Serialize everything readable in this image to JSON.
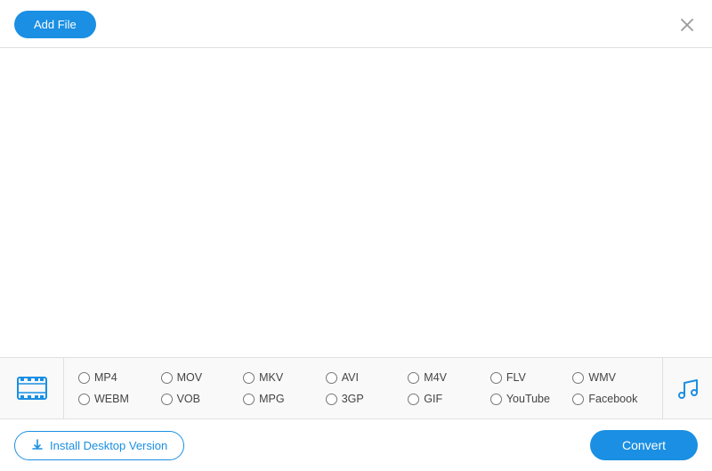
{
  "header": {
    "add_file_label": "Add File",
    "close_label": "✕"
  },
  "formats": {
    "video": [
      {
        "id": "mp4",
        "label": "MP4"
      },
      {
        "id": "mov",
        "label": "MOV"
      },
      {
        "id": "mkv",
        "label": "MKV"
      },
      {
        "id": "avi",
        "label": "AVI"
      },
      {
        "id": "m4v",
        "label": "M4V"
      },
      {
        "id": "flv",
        "label": "FLV"
      },
      {
        "id": "wmv",
        "label": "WMV"
      },
      {
        "id": "webm",
        "label": "WEBM"
      },
      {
        "id": "vob",
        "label": "VOB"
      },
      {
        "id": "mpg",
        "label": "MPG"
      },
      {
        "id": "3gp",
        "label": "3GP"
      },
      {
        "id": "gif",
        "label": "GIF"
      },
      {
        "id": "youtube",
        "label": "YouTube"
      },
      {
        "id": "facebook",
        "label": "Facebook"
      }
    ]
  },
  "footer": {
    "install_label": "Install Desktop Version",
    "convert_label": "Convert"
  }
}
